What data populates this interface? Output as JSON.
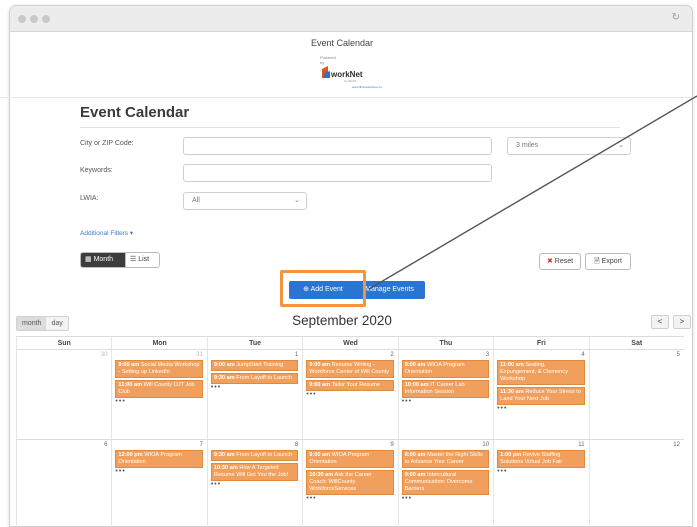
{
  "header": {
    "title": "Event Calendar",
    "logo": {
      "line1": "Powered",
      "line2": "by",
      "brand": "workNet",
      "sub": "ILLINOIS"
    }
  },
  "page": {
    "heading": "Event Calendar"
  },
  "filters": {
    "city_label": "City or ZIP Code:",
    "city_value": "",
    "radius_value": "3 miles",
    "keywords_label": "Keywords:",
    "keywords_value": "",
    "lwia_label": "LWIA:",
    "lwia_value": "All",
    "additional": "Additional Filters ▾"
  },
  "view_toggle": {
    "month": "Month",
    "list": "List"
  },
  "actions": {
    "reset": "Reset",
    "export": "Export",
    "add_event": "Add Event",
    "manage_events": "Manage Events"
  },
  "calendar": {
    "view_tabs": [
      "month",
      "day"
    ],
    "title": "September 2020",
    "prev": "<",
    "next": ">",
    "day_headers": [
      "Sun",
      "Mon",
      "Tue",
      "Wed",
      "Thu",
      "Fri",
      "Sat"
    ],
    "weeks": [
      [
        {
          "num": "30",
          "muted": true,
          "events": [],
          "more": ""
        },
        {
          "num": "31",
          "muted": true,
          "events": [
            {
              "time": "9:00 am",
              "text": "Social Media Workshop - Setting up LinkedIn"
            },
            {
              "time": "11:00 am",
              "text": "Will County OJT Job Club"
            }
          ],
          "more": "•••"
        },
        {
          "num": "1",
          "muted": false,
          "events": [
            {
              "time": "9:00 am",
              "text": "JumpStart Training"
            },
            {
              "time": "9:30 am",
              "text": "From Layoff to Launch"
            }
          ],
          "more": "•••"
        },
        {
          "num": "2",
          "muted": false,
          "events": [
            {
              "time": "9:00 am",
              "text": "Resume Writing - Workforce Center of Will County"
            },
            {
              "time": "9:00 am",
              "text": "Tailor Your Resume"
            }
          ],
          "more": "•••"
        },
        {
          "num": "3",
          "muted": false,
          "events": [
            {
              "time": "9:00 am",
              "text": "WIOA Program Orientation"
            },
            {
              "time": "10:00 am",
              "text": "IT Career Lab Information Session"
            }
          ],
          "more": "•••"
        },
        {
          "num": "4",
          "muted": false,
          "events": [
            {
              "time": "11:00 am",
              "text": "Sealing, Expungement, & Clemency Workshop"
            },
            {
              "time": "11:30 am",
              "text": "Reduce Your Stress to Land Your Next Job"
            }
          ],
          "more": "•••"
        },
        {
          "num": "5",
          "muted": false,
          "events": [],
          "more": ""
        }
      ],
      [
        {
          "num": "6",
          "muted": false,
          "events": [],
          "more": ""
        },
        {
          "num": "7",
          "muted": false,
          "events": [
            {
              "time": "12:00 pm",
              "text": "WIOA Program Orientation"
            }
          ],
          "more": "•••"
        },
        {
          "num": "8",
          "muted": false,
          "events": [
            {
              "time": "9:30 am",
              "text": "From Layoff to Launch"
            },
            {
              "time": "10:30 am",
              "text": "How A Targeted Resume Will Get You the Job!"
            }
          ],
          "more": "•••"
        },
        {
          "num": "9",
          "muted": false,
          "events": [
            {
              "time": "9:00 am",
              "text": "WIOA Program Orientation"
            },
            {
              "time": "10:30 am",
              "text": "Ask the Career Coach: WillCounty WorkforceServices"
            }
          ],
          "more": "•••"
        },
        {
          "num": "10",
          "muted": false,
          "events": [
            {
              "time": "8:00 am",
              "text": "Master the Right Skills to Advance Your Career"
            },
            {
              "time": "9:00 am",
              "text": "Intercultural Communication: Overcome Barriers"
            }
          ],
          "more": "•••"
        },
        {
          "num": "11",
          "muted": false,
          "events": [
            {
              "time": "1:00 pm",
              "text": "Revive Staffing Solutions Virtual Job Fair"
            }
          ],
          "more": "•••"
        },
        {
          "num": "12",
          "muted": false,
          "events": [],
          "more": ""
        }
      ]
    ]
  },
  "colors": {
    "accent": "#2b75d2",
    "event": "#f0a05c",
    "highlight": "#f29540"
  }
}
